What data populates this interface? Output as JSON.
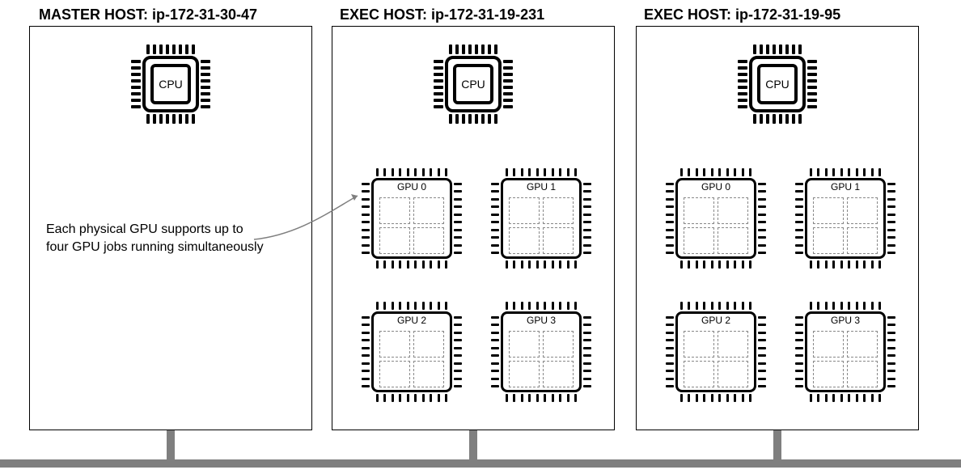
{
  "hosts": {
    "master": {
      "title": "MASTER HOST: ip-172-31-30-47",
      "cpu_label": "CPU"
    },
    "exec1": {
      "title": "EXEC HOST: ip-172-31-19-231",
      "cpu_label": "CPU",
      "gpus": [
        "GPU 0",
        "GPU 1",
        "GPU 2",
        "GPU 3"
      ]
    },
    "exec2": {
      "title": "EXEC HOST: ip-172-31-19-95",
      "cpu_label": "CPU",
      "gpus": [
        "GPU 0",
        "GPU 1",
        "GPU 2",
        "GPU 3"
      ]
    }
  },
  "annotation": {
    "text": "Each physical GPU supports up to four GPU jobs running simultaneously"
  }
}
